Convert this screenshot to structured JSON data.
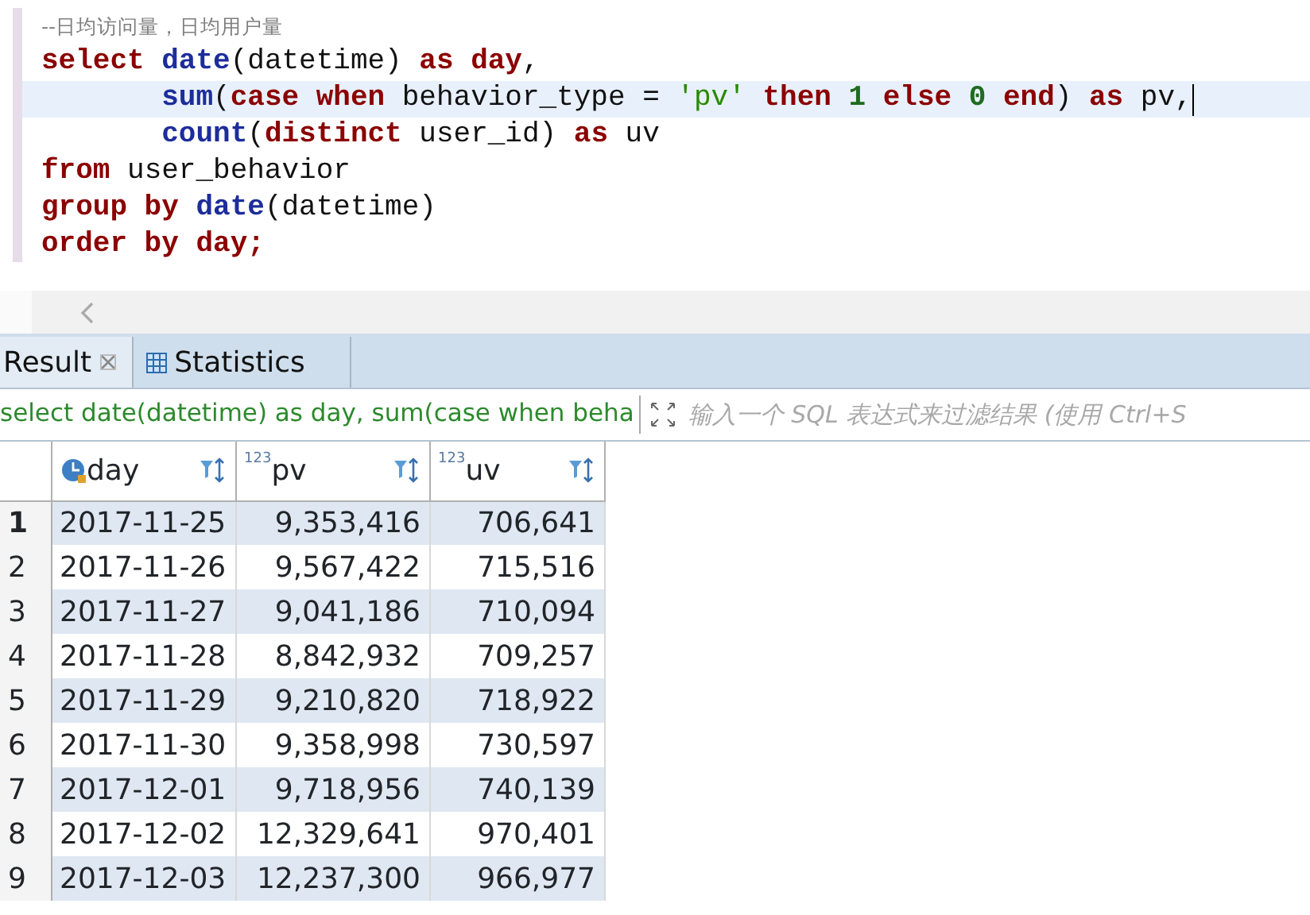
{
  "editor": {
    "lines": [
      {
        "current": false,
        "tokens": [
          {
            "kind": "comment",
            "text": "--日均访问量，日均用户量"
          }
        ]
      },
      {
        "current": false,
        "tokens": [
          {
            "kind": "kw",
            "text": "select "
          },
          {
            "kind": "fn",
            "text": "date"
          },
          {
            "kind": "plain",
            "text": "(datetime) "
          },
          {
            "kind": "kw",
            "text": "as day"
          },
          {
            "kind": "plain",
            "text": ","
          }
        ]
      },
      {
        "current": true,
        "tokens": [
          {
            "kind": "fn",
            "text": "       sum"
          },
          {
            "kind": "plain",
            "text": "("
          },
          {
            "kind": "kw",
            "text": "case when"
          },
          {
            "kind": "plain",
            "text": " behavior_type = "
          },
          {
            "kind": "str",
            "text": "'pv'"
          },
          {
            "kind": "kw",
            "text": " then "
          },
          {
            "kind": "num",
            "text": "1"
          },
          {
            "kind": "kw",
            "text": " else "
          },
          {
            "kind": "num",
            "text": "0"
          },
          {
            "kind": "kw",
            "text": " end"
          },
          {
            "kind": "plain",
            "text": ") "
          },
          {
            "kind": "kw",
            "text": "as"
          },
          {
            "kind": "plain",
            "text": " pv,"
          }
        ]
      },
      {
        "current": false,
        "tokens": [
          {
            "kind": "fn",
            "text": "       count"
          },
          {
            "kind": "plain",
            "text": "("
          },
          {
            "kind": "kw",
            "text": "distinct"
          },
          {
            "kind": "plain",
            "text": " user_id) "
          },
          {
            "kind": "kw",
            "text": "as"
          },
          {
            "kind": "plain",
            "text": " uv"
          }
        ]
      },
      {
        "current": false,
        "tokens": [
          {
            "kind": "kw",
            "text": "from"
          },
          {
            "kind": "plain",
            "text": " user_behavior"
          }
        ]
      },
      {
        "current": false,
        "tokens": [
          {
            "kind": "kw",
            "text": "group by "
          },
          {
            "kind": "fn",
            "text": "date"
          },
          {
            "kind": "plain",
            "text": "(datetime)"
          }
        ]
      },
      {
        "current": false,
        "tokens": [
          {
            "kind": "kw",
            "text": "order by day;"
          }
        ]
      }
    ]
  },
  "tabs": [
    {
      "label": "Result",
      "selected": true,
      "kind": "result"
    },
    {
      "label": "Statistics",
      "selected": false,
      "kind": "stats"
    }
  ],
  "filter": {
    "query": "select date(datetime) as day, sum(case when beha",
    "placeholder": "输入一个 SQL 表达式来过滤结果 (使用 Ctrl+S"
  },
  "table": {
    "columns": [
      {
        "label": "day",
        "kind": "date"
      },
      {
        "label": "pv",
        "kind": "number",
        "type_label": "123"
      },
      {
        "label": "uv",
        "kind": "number",
        "type_label": "123"
      }
    ],
    "rows": [
      {
        "number": "1",
        "selected": true,
        "cells": [
          "2017-11-25",
          "9,353,416",
          "706,641"
        ]
      },
      {
        "number": "2",
        "selected": false,
        "cells": [
          "2017-11-26",
          "9,567,422",
          "715,516"
        ]
      },
      {
        "number": "3",
        "selected": false,
        "cells": [
          "2017-11-27",
          "9,041,186",
          "710,094"
        ]
      },
      {
        "number": "4",
        "selected": false,
        "cells": [
          "2017-11-28",
          "8,842,932",
          "709,257"
        ]
      },
      {
        "number": "5",
        "selected": false,
        "cells": [
          "2017-11-29",
          "9,210,820",
          "718,922"
        ]
      },
      {
        "number": "6",
        "selected": false,
        "cells": [
          "2017-11-30",
          "9,358,998",
          "730,597"
        ]
      },
      {
        "number": "7",
        "selected": false,
        "cells": [
          "2017-12-01",
          "9,718,956",
          "740,139"
        ]
      },
      {
        "number": "8",
        "selected": false,
        "cells": [
          "2017-12-02",
          "12,329,641",
          "970,401"
        ]
      },
      {
        "number": "9",
        "selected": false,
        "cells": [
          "2017-12-03",
          "12,237,300",
          "966,977"
        ]
      }
    ]
  }
}
